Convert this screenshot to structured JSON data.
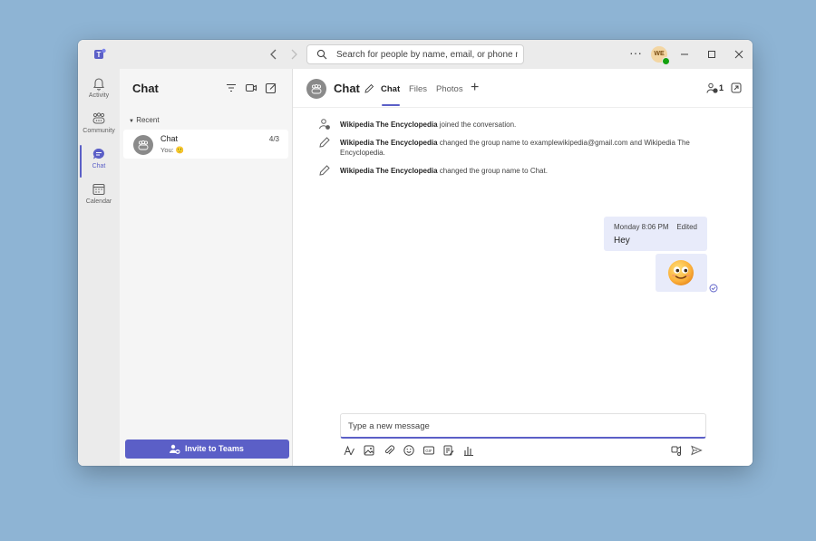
{
  "titlebar": {
    "search_placeholder": "Search for people by name, email, or phone nu",
    "user_initials": "WE",
    "more_label": "···"
  },
  "rail": {
    "items": [
      {
        "label": "Activity",
        "icon": "bell-icon"
      },
      {
        "label": "Community",
        "icon": "community-icon"
      },
      {
        "label": "Chat",
        "icon": "chat-icon"
      },
      {
        "label": "Calendar",
        "icon": "calendar-icon"
      }
    ]
  },
  "chat_list": {
    "title": "Chat",
    "recent_label": "Recent",
    "items": [
      {
        "name": "Chat",
        "date": "4/3",
        "preview": "You: 🙂"
      }
    ],
    "invite_label": "Invite to Teams"
  },
  "conversation": {
    "name": "Chat",
    "tabs": [
      {
        "label": "Chat",
        "active": true
      },
      {
        "label": "Files",
        "active": false
      },
      {
        "label": "Photos",
        "active": false
      }
    ],
    "participant_count": "1",
    "events": [
      {
        "actor": "Wikipedia The Encyclopedia",
        "text": " joined the conversation."
      },
      {
        "actor": "Wikipedia The Encyclopedia",
        "text": " changed the group name to examplewikipedia@gmail.com and Wikipedia The Encyclopedia."
      },
      {
        "actor": "Wikipedia The Encyclopedia",
        "text": " changed the group name to Chat."
      }
    ],
    "message": {
      "timestamp": "Monday 8:06 PM",
      "edited_label": "Edited",
      "text": "Hey"
    }
  },
  "compose": {
    "placeholder": "Type a new message"
  },
  "colors": {
    "accent": "#5b5fc7",
    "bubble": "#e8ebfa",
    "presence": "#13a10e",
    "desktop": "#8eb4d4"
  }
}
